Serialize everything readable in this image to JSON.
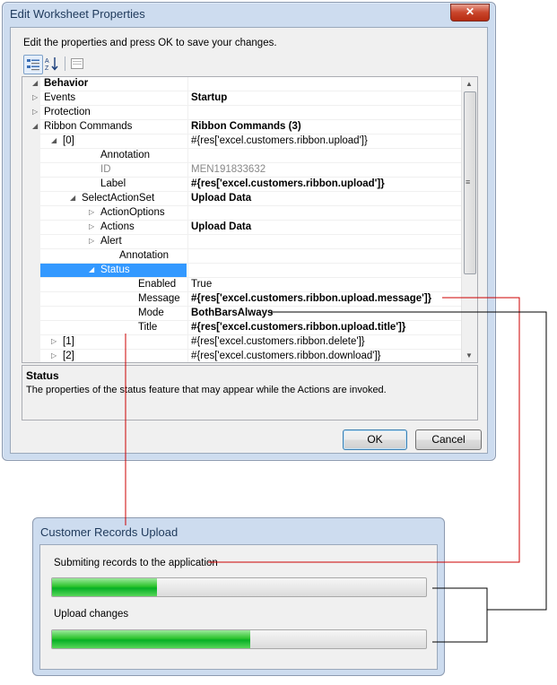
{
  "dialog1": {
    "title": "Edit Worksheet Properties",
    "close_glyph": "✕",
    "instructions": "Edit the properties and press OK to save your changes.",
    "grid_rows": [
      {
        "name": "Behavior",
        "value": "",
        "indent": 0,
        "expander": "collapse",
        "style": "category"
      },
      {
        "name": "Events",
        "value": "Startup",
        "indent": 0,
        "expander": "expand",
        "style": "bold-value"
      },
      {
        "name": "Protection",
        "value": "",
        "indent": 0,
        "expander": "expand",
        "style": "normal"
      },
      {
        "name": "Ribbon Commands",
        "value": "Ribbon Commands (3)",
        "indent": 0,
        "expander": "collapse",
        "style": "bold-value"
      },
      {
        "name": "[0]",
        "value": "#{res['excel.customers.ribbon.upload']}",
        "indent": 1,
        "expander": "collapse",
        "style": "normal"
      },
      {
        "name": "Annotation",
        "value": "",
        "indent": 3,
        "expander": "none",
        "style": "normal"
      },
      {
        "name": "ID",
        "value": "MEN191833632",
        "indent": 3,
        "expander": "none",
        "style": "gray"
      },
      {
        "name": "Label",
        "value": "#{res['excel.customers.ribbon.upload']}",
        "indent": 3,
        "expander": "none",
        "style": "bold-value"
      },
      {
        "name": "SelectActionSet",
        "value": "Upload Data",
        "indent": 2,
        "expander": "collapse",
        "style": "bold-value"
      },
      {
        "name": "ActionOptions",
        "value": "",
        "indent": 3,
        "expander": "expand",
        "style": "normal"
      },
      {
        "name": "Actions",
        "value": "Upload Data",
        "indent": 3,
        "expander": "expand",
        "style": "bold-value"
      },
      {
        "name": "Alert",
        "value": "",
        "indent": 3,
        "expander": "expand",
        "style": "normal"
      },
      {
        "name": "Annotation",
        "value": "",
        "indent": 4,
        "expander": "none",
        "style": "normal"
      },
      {
        "name": "Status",
        "value": "",
        "indent": 3,
        "expander": "collapse",
        "style": "selected"
      },
      {
        "name": "Enabled",
        "value": "True",
        "indent": 5,
        "expander": "none",
        "style": "normal"
      },
      {
        "name": "Message",
        "value": "#{res['excel.customers.ribbon.upload.message']}",
        "indent": 5,
        "expander": "none",
        "style": "bold-value"
      },
      {
        "name": "Mode",
        "value": "BothBarsAlways",
        "indent": 5,
        "expander": "none",
        "style": "bold-value"
      },
      {
        "name": "Title",
        "value": "#{res['excel.customers.ribbon.upload.title']}",
        "indent": 5,
        "expander": "none",
        "style": "bold-value"
      },
      {
        "name": "[1]",
        "value": "#{res['excel.customers.ribbon.delete']}",
        "indent": 1,
        "expander": "expand",
        "style": "normal"
      },
      {
        "name": "[2]",
        "value": "#{res['excel.customers.ribbon.download']}",
        "indent": 1,
        "expander": "expand",
        "style": "normal"
      }
    ],
    "description": {
      "title": "Status",
      "text": "The properties of the status feature that may appear while the Actions are invoked."
    },
    "ok_label": "OK",
    "cancel_label": "Cancel"
  },
  "dialog2": {
    "title": "Customer Records Upload",
    "message": "Submiting records to the application",
    "progress1": 0.28,
    "step_label": "Upload changes",
    "progress2": 0.53
  },
  "colors": {
    "selection": "#3399ff",
    "callout_red": "#cc0000",
    "callout_black": "#000000",
    "progress_green": "#06b025"
  }
}
